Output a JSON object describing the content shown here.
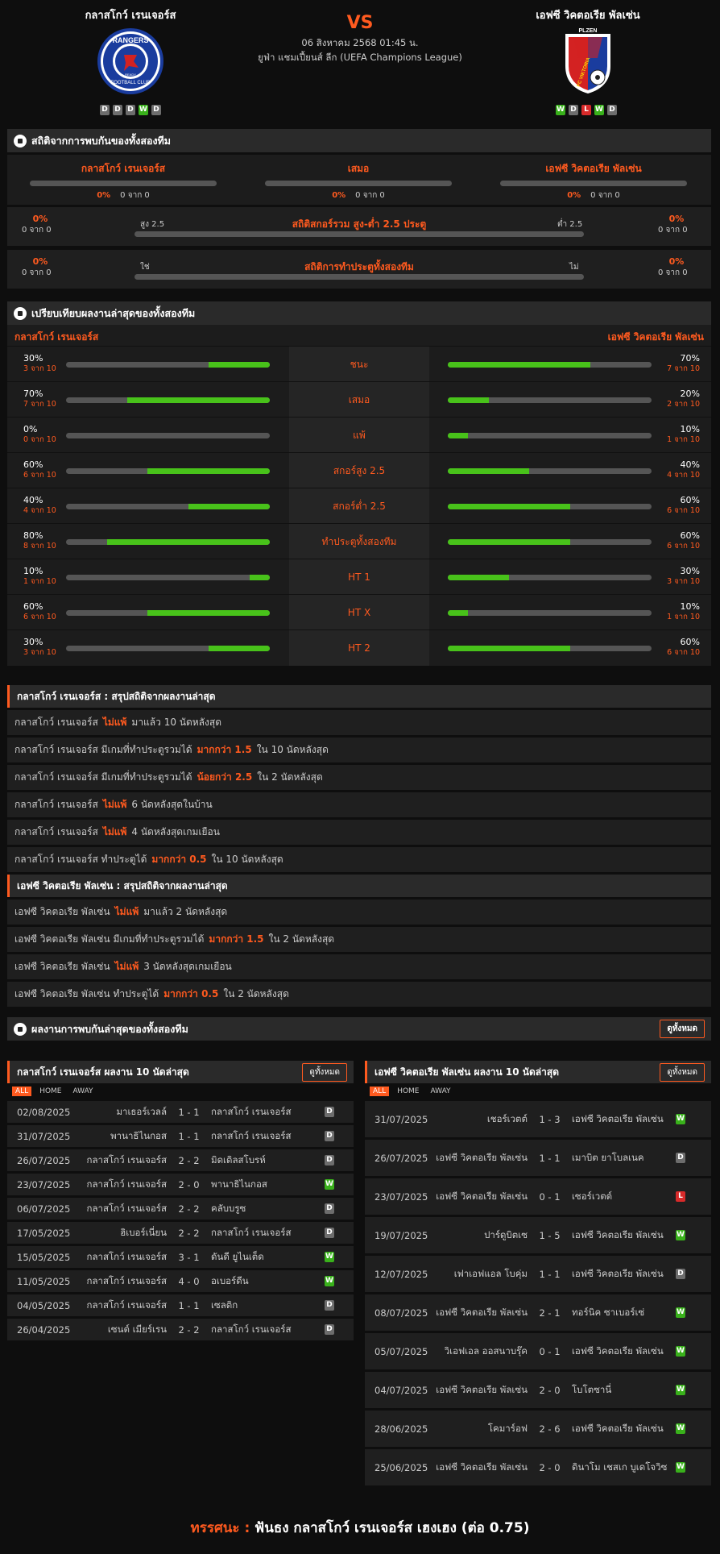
{
  "header": {
    "home_name": "กลาสโกว์ เรนเจอร์ส",
    "away_name": "เอฟซี วิคตอเรีย พัลเซ่น",
    "vs": "VS",
    "datetime": "06 สิงหาคม 2568 01:45 น.",
    "league": "ยูฟ่า แชมเปี้ยนส์ ลีก (UEFA Champions League)",
    "home_logo_text": "RANGERS",
    "home_logo_sub": "FOOTBALL CLUB",
    "home_logo_ready": "READY",
    "away_logo_top": "PLZEN",
    "away_logo_text": "FC VIKTORIA",
    "home_form": [
      "D",
      "D",
      "D",
      "W",
      "D"
    ],
    "away_form": [
      "W",
      "D",
      "L",
      "W",
      "D"
    ]
  },
  "h2h": {
    "title": "สถิติจากการพบกันของทั้งสองทีม",
    "cols": [
      {
        "label": "กลาสโกว์ เรนเจอร์ส",
        "pct": "0%",
        "count": "0 จาก 0"
      },
      {
        "label": "เสมอ",
        "pct": "0%",
        "count": "0 จาก 0"
      },
      {
        "label": "เอฟซี วิคตอเรีย พัลเซ่น",
        "pct": "0%",
        "count": "0 จาก 0"
      }
    ],
    "ou": {
      "title": "สถิติสกอร์รวม สูง-ต่ำ 2.5 ประตู",
      "left_label": "สูง 2.5",
      "right_label": "ต่ำ 2.5",
      "left_pct": "0%",
      "left_count": "0 จาก 0",
      "right_pct": "0%",
      "right_count": "0 จาก 0"
    },
    "btts": {
      "title": "สถิติการทำประตูทั้งสองทีม",
      "left_label": "ใช่",
      "right_label": "ไม่",
      "left_pct": "0%",
      "left_count": "0 จาก 0",
      "right_pct": "0%",
      "right_count": "0 จาก 0"
    }
  },
  "compare": {
    "title": "เปรียบเทียบผลงานล่าสุดของทั้งสองทีม",
    "home": "กลาสโกว์ เรนเจอร์ส",
    "away": "เอฟซี วิคตอเรีย พัลเซ่น",
    "rows": [
      {
        "label": "ชนะ",
        "hp": "30%",
        "hc": "3 จาก 10",
        "hv": 0.3,
        "ap": "70%",
        "ac": "7 จาก 10",
        "av": 0.7
      },
      {
        "label": "เสมอ",
        "hp": "70%",
        "hc": "7 จาก 10",
        "hv": 0.7,
        "ap": "20%",
        "ac": "2 จาก 10",
        "av": 0.2
      },
      {
        "label": "แพ้",
        "hp": "0%",
        "hc": "0 จาก 10",
        "hv": 0,
        "ap": "10%",
        "ac": "1 จาก 10",
        "av": 0.1
      },
      {
        "label": "สกอร์สูง 2.5",
        "hp": "60%",
        "hc": "6 จาก 10",
        "hv": 0.6,
        "ap": "40%",
        "ac": "4 จาก 10",
        "av": 0.4
      },
      {
        "label": "สกอร์ต่ำ 2.5",
        "hp": "40%",
        "hc": "4 จาก 10",
        "hv": 0.4,
        "ap": "60%",
        "ac": "6 จาก 10",
        "av": 0.6
      },
      {
        "label": "ทำประตูทั้งสองทีม",
        "hp": "80%",
        "hc": "8 จาก 10",
        "hv": 0.8,
        "ap": "60%",
        "ac": "6 จาก 10",
        "av": 0.6
      },
      {
        "label": "HT 1",
        "hp": "10%",
        "hc": "1 จาก 10",
        "hv": 0.1,
        "ap": "30%",
        "ac": "3 จาก 10",
        "av": 0.3
      },
      {
        "label": "HT X",
        "hp": "60%",
        "hc": "6 จาก 10",
        "hv": 0.6,
        "ap": "10%",
        "ac": "1 จาก 10",
        "av": 0.1
      },
      {
        "label": "HT 2",
        "hp": "30%",
        "hc": "3 จาก 10",
        "hv": 0.3,
        "ap": "60%",
        "ac": "6 จาก 10",
        "av": 0.6
      }
    ]
  },
  "home_summary": {
    "title": "กลาสโกว์ เรนเจอร์ส : สรุปสถิติจากผลงานล่าสุด",
    "rows": [
      {
        "a": "กลาสโกว์ เรนเจอร์ส",
        "h": "ไม่แพ้",
        "b": "มาแล้ว 10 นัดหลังสุด"
      },
      {
        "a": "กลาสโกว์ เรนเจอร์ส มีเกมที่ทำประตูรวมได้",
        "h": "มากกว่า 1.5",
        "b": "ใน 10 นัดหลังสุด"
      },
      {
        "a": "กลาสโกว์ เรนเจอร์ส มีเกมที่ทำประตูรวมได้",
        "h": "น้อยกว่า 2.5",
        "b": "ใน 2 นัดหลังสุด"
      },
      {
        "a": "กลาสโกว์ เรนเจอร์ส",
        "h": "ไม่แพ้",
        "b": "6 นัดหลังสุดในบ้าน"
      },
      {
        "a": "กลาสโกว์ เรนเจอร์ส",
        "h": "ไม่แพ้",
        "b": "4 นัดหลังสุดเกมเยือน"
      },
      {
        "a": "กลาสโกว์ เรนเจอร์ส ทำประตูได้",
        "h": "มากกว่า 0.5",
        "b": "ใน 10 นัดหลังสุด"
      }
    ]
  },
  "away_summary": {
    "title": "เอฟซี วิคตอเรีย พัลเซ่น : สรุปสถิติจากผลงานล่าสุด",
    "rows": [
      {
        "a": "เอฟซี วิคตอเรีย พัลเซ่น",
        "h": "ไม่แพ้",
        "b": "มาแล้ว 2 นัดหลังสุด"
      },
      {
        "a": "เอฟซี วิคตอเรีย พัลเซ่น มีเกมที่ทำประตูรวมได้",
        "h": "มากกว่า 1.5",
        "b": "ใน 2 นัดหลังสุด"
      },
      {
        "a": "เอฟซี วิคตอเรีย พัลเซ่น",
        "h": "ไม่แพ้",
        "b": "3 นัดหลังสุดเกมเยือน"
      },
      {
        "a": "เอฟซี วิคตอเรีย พัลเซ่น ทำประตูได้",
        "h": "มากกว่า 0.5",
        "b": "ใน 2 นัดหลังสุด"
      }
    ]
  },
  "recent": {
    "title": "ผลงานการพบกันล่าสุดของทั้งสองทีม",
    "see_all": "ดูทั้งหมด",
    "tabs": [
      "ALL",
      "HOME",
      "AWAY"
    ],
    "home_title": "กลาสโกว์ เรนเจอร์ส ผลงาน 10 นัดล่าสุด",
    "away_title": "เอฟซี วิคตอเรีย พัลเซ่น ผลงาน 10 นัดล่าสุด",
    "home_matches": [
      {
        "d": "02/08/2025",
        "h": "มาเธอร์เวลล์",
        "s": "1 - 1",
        "a": "กลาสโกว์ เรนเจอร์ส",
        "r": "D"
      },
      {
        "d": "31/07/2025",
        "h": "พานาธิไนกอส",
        "s": "1 - 1",
        "a": "กลาสโกว์ เรนเจอร์ส",
        "r": "D"
      },
      {
        "d": "26/07/2025",
        "h": "กลาสโกว์ เรนเจอร์ส",
        "s": "2 - 2",
        "a": "มิดเดิลสโบรห์",
        "r": "D"
      },
      {
        "d": "23/07/2025",
        "h": "กลาสโกว์ เรนเจอร์ส",
        "s": "2 - 0",
        "a": "พานาธิไนกอส",
        "r": "W"
      },
      {
        "d": "06/07/2025",
        "h": "กลาสโกว์ เรนเจอร์ส",
        "s": "2 - 2",
        "a": "คลับบรูซ",
        "r": "D"
      },
      {
        "d": "17/05/2025",
        "h": "ฮิเบอร์เนี่ยน",
        "s": "2 - 2",
        "a": "กลาสโกว์ เรนเจอร์ส",
        "r": "D"
      },
      {
        "d": "15/05/2025",
        "h": "กลาสโกว์ เรนเจอร์ส",
        "s": "3 - 1",
        "a": "ดันดี ยูไนเต็ด",
        "r": "W"
      },
      {
        "d": "11/05/2025",
        "h": "กลาสโกว์ เรนเจอร์ส",
        "s": "4 - 0",
        "a": "อเบอร์ดีน",
        "r": "W"
      },
      {
        "d": "04/05/2025",
        "h": "กลาสโกว์ เรนเจอร์ส",
        "s": "1 - 1",
        "a": "เซลติก",
        "r": "D"
      },
      {
        "d": "26/04/2025",
        "h": "เซนต์ เมียร์เรน",
        "s": "2 - 2",
        "a": "กลาสโกว์ เรนเจอร์ส",
        "r": "D"
      }
    ],
    "away_matches": [
      {
        "d": "31/07/2025",
        "h": "เชอร์เวตต์",
        "s": "1 - 3",
        "a": "เอฟซี วิคตอเรีย พัลเซ่น",
        "r": "W"
      },
      {
        "d": "26/07/2025",
        "h": "เอฟซี วิคตอเรีย พัลเซ่น",
        "s": "1 - 1",
        "a": "เมาบิต ยาโบลเนค",
        "r": "D"
      },
      {
        "d": "23/07/2025",
        "h": "เอฟซี วิคตอเรีย พัลเซ่น",
        "s": "0 - 1",
        "a": "เซอร์เวตต์",
        "r": "L"
      },
      {
        "d": "19/07/2025",
        "h": "ปาร์ดูบิตเซ",
        "s": "1 - 5",
        "a": "เอฟซี วิคตอเรีย พัลเซ่น",
        "r": "W"
      },
      {
        "d": "12/07/2025",
        "h": "เฟาเอฟแอล โบคุ่ม",
        "s": "1 - 1",
        "a": "เอฟซี วิคตอเรีย พัลเซ่น",
        "r": "D"
      },
      {
        "d": "08/07/2025",
        "h": "เอฟซี วิคตอเรีย พัลเซ่น",
        "s": "2 - 1",
        "a": "ทอร์นิค ซาเบอร์เซ่",
        "r": "W"
      },
      {
        "d": "05/07/2025",
        "h": "วิเอฟเอล ออสนาบรุ๊ค",
        "s": "0 - 1",
        "a": "เอฟซี วิคตอเรีย พัลเซ่น",
        "r": "W"
      },
      {
        "d": "04/07/2025",
        "h": "เอฟซี วิคตอเรีย พัลเซ่น",
        "s": "2 - 0",
        "a": "โบโตซานี่",
        "r": "W"
      },
      {
        "d": "28/06/2025",
        "h": "โคมาร์อฟ",
        "s": "2 - 6",
        "a": "เอฟซี วิคตอเรีย พัลเซ่น",
        "r": "W"
      },
      {
        "d": "25/06/2025",
        "h": "เอฟซี วิคตอเรีย พัลเซ่น",
        "s": "2 - 0",
        "a": "ดินาโม เชสเก บูเดโจวิซ",
        "r": "W"
      }
    ]
  },
  "footer": {
    "label": "ทรรศนะ :",
    "text": "ฟันธง กลาสโกว์ เรนเจอร์ส เฮงเฮง (ต่อ 0.75)"
  },
  "colors": {
    "accent": "#ff5a1f",
    "win": "#39b11b",
    "draw": "#6d6d6d",
    "loss": "#d82a2a",
    "bar_fill": "#48c21a"
  }
}
